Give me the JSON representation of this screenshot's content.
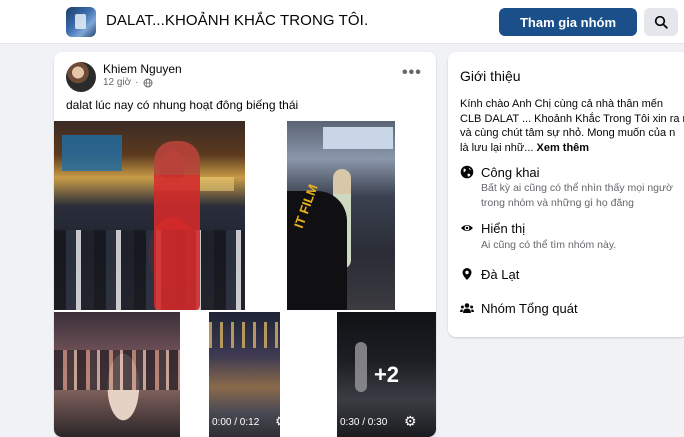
{
  "header": {
    "group_name": "DALAT...KHOẢNH KHẮC TRONG TÔI.",
    "join_label": "Tham gia nhóm"
  },
  "post": {
    "author": "Khiem Nguyen",
    "time": "12 giờ",
    "more": "•••",
    "text": "dalat lúc nay có nhung hoạt đông biếng thái",
    "video1_time": "0:00 / 0:12",
    "video2_time": "0:30 / 0:30",
    "extra_count": "+2"
  },
  "about": {
    "title": "Giới thiệu",
    "intro_lines": [
      "Kính chào Anh Chị cùng cả nhà thân mến",
      "CLB DALAT ... Khoảnh Khắc Trong Tôi xin ra m",
      "và cùng chút tâm sự nhỏ. Mong muốn của n",
      "là lưu lại nhữ..."
    ],
    "see_more": "Xem thêm",
    "public_title": "Công khai",
    "public_desc_1": "Bất kỳ ai cũng có thể nhìn thấy mọi ngườ",
    "public_desc_2": "trong nhóm và những gì họ đăng",
    "visible_title": "Hiển thị",
    "visible_desc": "Ai cũng có thể tìm nhóm này.",
    "location": "Đà Lạt",
    "group_type": "Nhóm Tổng quát"
  },
  "colors": {
    "join_button": "#1b4f8a",
    "background": "#f0f2f5",
    "secondary_text": "#65676b"
  },
  "icons": [
    "search-icon",
    "globe-icon",
    "eye-icon",
    "location-pin-icon",
    "people-icon",
    "play-icon",
    "replay-icon",
    "gear-icon",
    "more-options-icon"
  ]
}
